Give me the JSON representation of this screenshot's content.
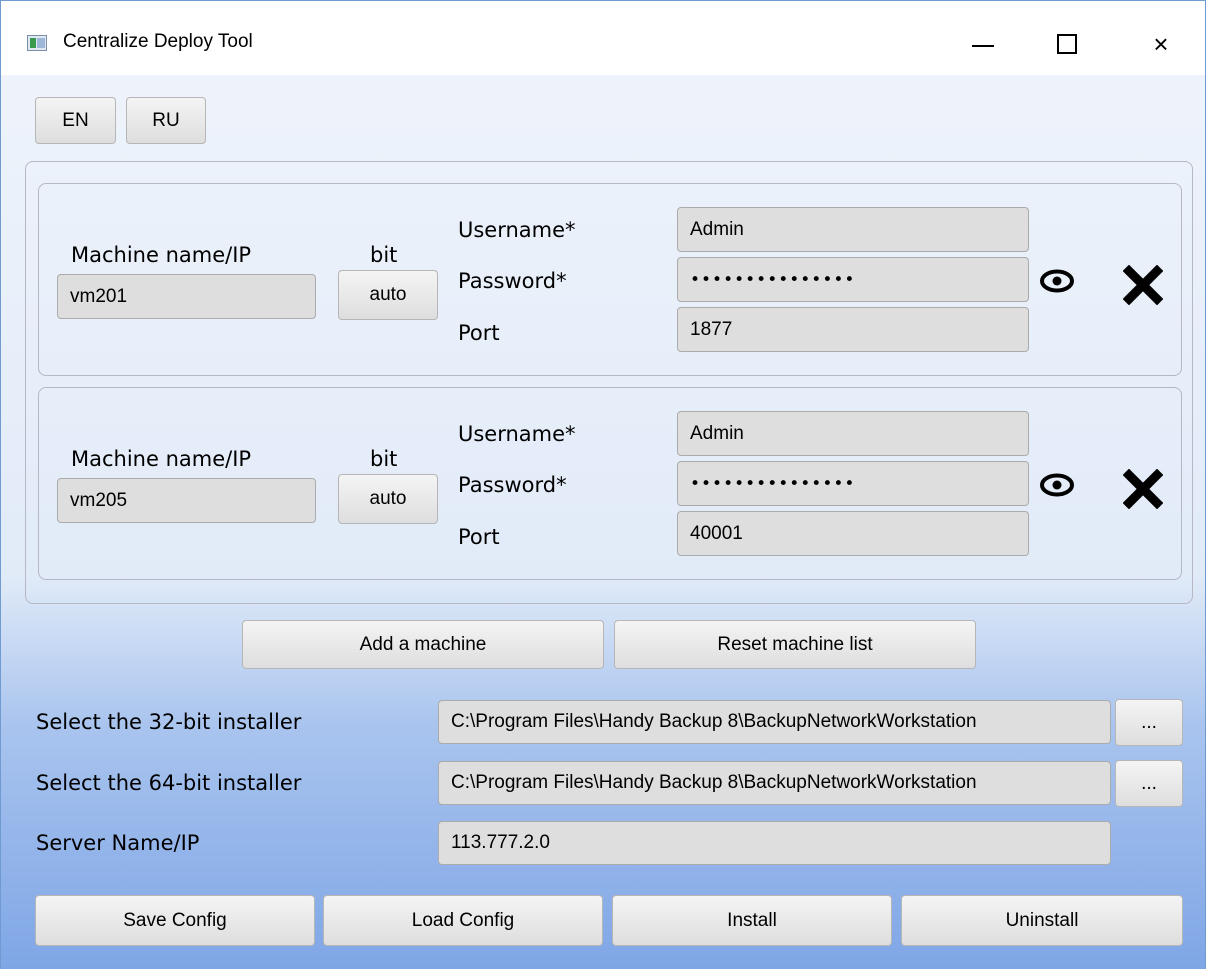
{
  "window": {
    "title": "Centralize Deploy Tool",
    "minimize": "—",
    "close": "×"
  },
  "lang": {
    "en": "EN",
    "ru": "RU"
  },
  "machines": [
    {
      "machine_label": "Machine name/IP",
      "machine_value": "vm201",
      "bit_label": "bit",
      "bit_button": "auto",
      "username_label": "Username*",
      "username_value": "Admin",
      "password_label": "Password*",
      "password_value": "•••••••••••••••",
      "port_label": "Port",
      "port_value": "1877"
    },
    {
      "machine_label": "Machine name/IP",
      "machine_value": "vm205",
      "bit_label": "bit",
      "bit_button": "auto",
      "username_label": "Username*",
      "username_value": "Admin",
      "password_label": "Password*",
      "password_value": "•••••••••••••••",
      "port_label": "Port",
      "port_value": "40001"
    }
  ],
  "actions": {
    "add_machine": "Add a machine",
    "reset_list": "Reset machine list"
  },
  "installers": {
    "label_32": "Select the 32-bit installer",
    "value_32": "C:\\Program Files\\Handy Backup 8\\BackupNetworkWorkstation",
    "label_64": "Select the 64-bit installer",
    "value_64": "C:\\Program Files\\Handy Backup 8\\BackupNetworkWorkstation",
    "browse": "...",
    "server_label": "Server Name/IP",
    "server_value": "113.777.2.0"
  },
  "footer": {
    "save": "Save Config",
    "load": "Load Config",
    "install": "Install",
    "uninstall": "Uninstall"
  },
  "icons": {
    "show_password": "eye-icon",
    "remove_machine": "x-icon"
  },
  "colors": {
    "gradient_top": "#eef3fb",
    "gradient_bottom": "#7fa6e6",
    "window_border": "#6f9bd1"
  }
}
